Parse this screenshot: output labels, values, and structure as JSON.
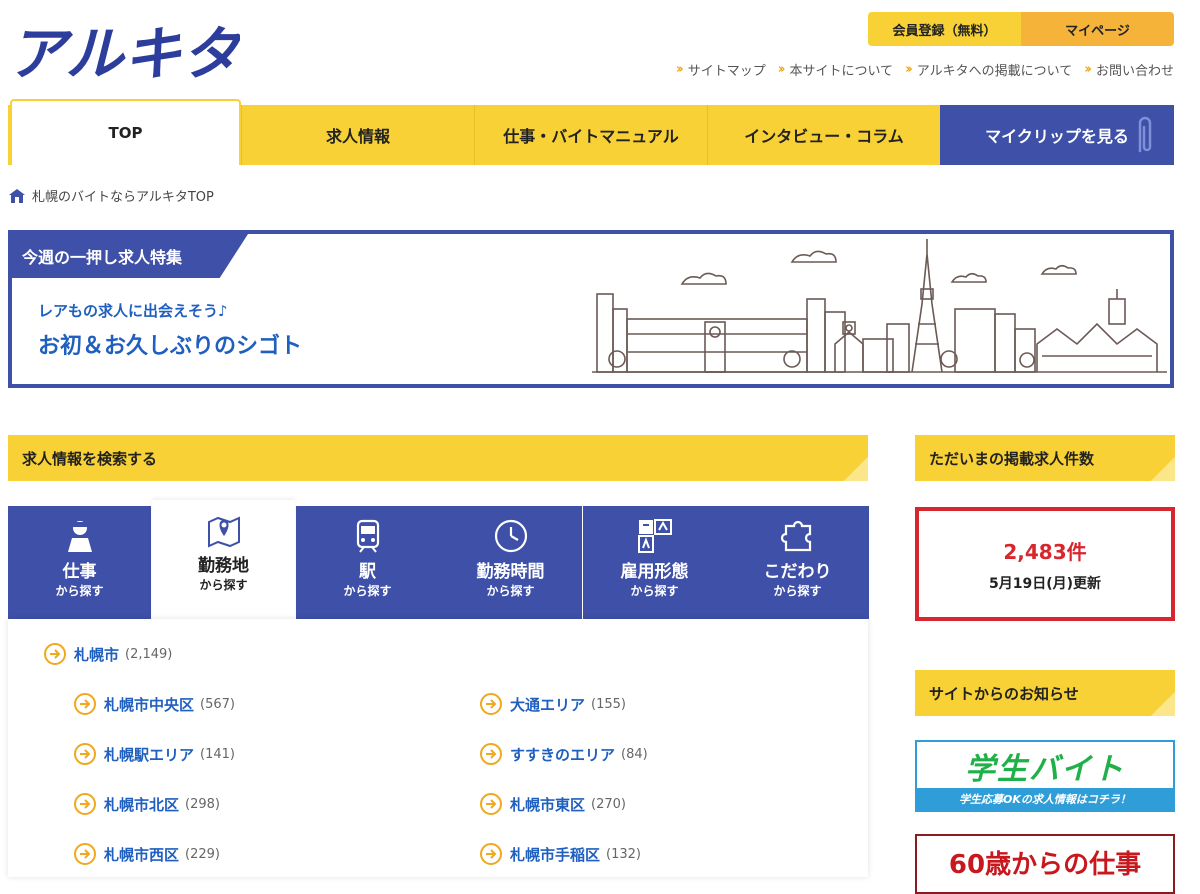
{
  "logo": {
    "text": "アルキタ"
  },
  "header": {
    "register": "会員登録（無料）",
    "mypage": "マイページ",
    "links": [
      "サイトマップ",
      "本サイトについて",
      "アルキタへの掲載について",
      "お問い合わせ"
    ]
  },
  "nav": {
    "items": [
      "TOP",
      "求人情報",
      "仕事・バイトマニュアル",
      "インタビュー・コラム",
      "マイクリップを見る"
    ]
  },
  "breadcrumb": "札幌のバイトならアルキタTOP",
  "feature": {
    "tag": "今週の一押し求人特集",
    "subtitle": "レアもの求人に出会えそう♪",
    "title": "お初＆お久しぶりのシゴト"
  },
  "search": {
    "heading": "求人情報を検索する",
    "tabs": [
      {
        "label": "仕事",
        "sub": "から探す",
        "icon": "worker-icon"
      },
      {
        "label": "勤務地",
        "sub": "から探す",
        "icon": "map-pin-icon"
      },
      {
        "label": "駅",
        "sub": "から探す",
        "icon": "train-icon"
      },
      {
        "label": "勤務時間",
        "sub": "から探す",
        "icon": "clock-icon"
      },
      {
        "label": "雇用形態",
        "sub": "から探す",
        "icon": "employment-type-icon"
      },
      {
        "label": "こだわり",
        "sub": "から探す",
        "icon": "puzzle-icon"
      }
    ],
    "active_tab": "勤務地",
    "parent_area": {
      "name": "札幌市",
      "count": "(2,149)"
    },
    "areas": [
      {
        "name": "札幌市中央区",
        "count": "(567)"
      },
      {
        "name": "大通エリア",
        "count": "(155)"
      },
      {
        "name": "札幌駅エリア",
        "count": "(141)"
      },
      {
        "name": "すすきのエリア",
        "count": "(84)"
      },
      {
        "name": "札幌市北区",
        "count": "(298)"
      },
      {
        "name": "札幌市東区",
        "count": "(270)"
      },
      {
        "name": "札幌市西区",
        "count": "(229)"
      },
      {
        "name": "札幌市手稲区",
        "count": "(132)"
      }
    ]
  },
  "jobcount": {
    "heading": "ただいまの掲載求人件数",
    "count": "2,483件",
    "updated": "5月19日(月)更新"
  },
  "notices": {
    "heading": "サイトからのお知らせ",
    "gakusei_title": "学生バイト",
    "gakusei_sub": "学生応募OKの求人情報はコチラ！",
    "sixty_title": "60歳からの仕事"
  },
  "colors": {
    "yellow": "#f7d135",
    "navy": "#3e50a8",
    "orange": "#f6b33a",
    "link_blue": "#1f5fbf",
    "red": "#d8262e"
  }
}
